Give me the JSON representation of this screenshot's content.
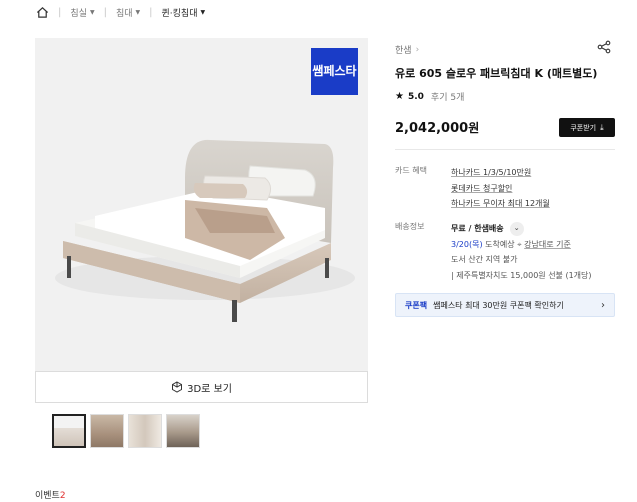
{
  "breadcrumb": {
    "home_icon": "home-icon",
    "items": [
      {
        "label": "침실"
      },
      {
        "label": "침대"
      },
      {
        "label": "퀸·킹침대"
      }
    ]
  },
  "product": {
    "brand": "한샘",
    "title": "유로 605 슬로우 패브릭침대 K (매트별도)",
    "rating": "5.0",
    "reviews": "후기 5개",
    "price": "2,042,000",
    "price_unit": "원",
    "coupon_download_label": "쿠폰받기",
    "badge_text": "쌤페스타"
  },
  "gallery": {
    "view3d_label": "3D로 보기",
    "thumbnails": 4,
    "selected_index": 0
  },
  "card_benefit": {
    "label": "카드 혜택",
    "items": [
      "하나카드 1/3/5/10만원",
      "롯데카드 청구할인",
      "하나카드 무이자 최대 12개월"
    ]
  },
  "shipping": {
    "label": "배송정보",
    "method": "무료 / 한샘배송",
    "date": "3/20(목)",
    "date_suffix": " 도착예상",
    "location": "강남대로 기준",
    "note1": "도서 산간 지역 불가",
    "note2": "| 제주특별자치도 15,000원 선불 (1개당)"
  },
  "coupon_pack": {
    "tag": "쿠폰팩",
    "text": "쌤페스타 최대 30만원 쿠폰팩 확인하기"
  },
  "event": {
    "label": "이벤트",
    "count": "2"
  },
  "colors": {
    "accent_blue": "#1a3cc7",
    "price_red": "#e03131"
  }
}
